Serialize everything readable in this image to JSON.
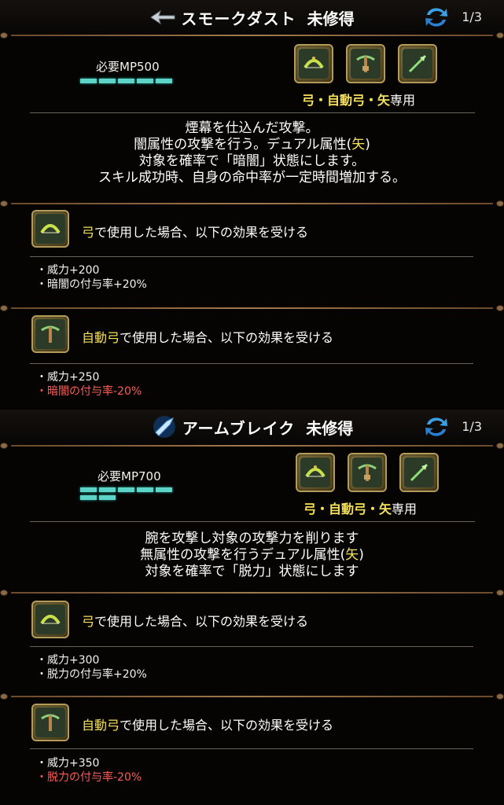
{
  "skills": [
    {
      "name": "スモークダスト",
      "status": "未修得",
      "page": "1/3",
      "mp": "必要MP500",
      "mp_bars": 5,
      "weapons": [
        "bow",
        "crossbow",
        "arrow"
      ],
      "weapon_caption": {
        "hl": "弓・自動弓・矢",
        "plain": "専用"
      },
      "description": [
        [
          {
            "t": "煙幕を仕込んだ攻撃。"
          }
        ],
        [
          {
            "t": "闇属性の攻撃を行う。デュアル属性("
          },
          {
            "t": "矢",
            "hl": true
          },
          {
            "t": ")"
          }
        ],
        [
          {
            "t": "対象を確率で「暗闇」状態にします。"
          }
        ],
        [
          {
            "t": "スキル成功時、自身の命中率が一定時間増加する。"
          }
        ]
      ],
      "effects": [
        {
          "weapon": "bow",
          "head_hl": "弓",
          "head": "で使用した場合、以下の効果を受ける",
          "lines": [
            {
              "t": "・威力+200",
              "neg": false
            },
            {
              "t": "・暗闇の付与率+20%",
              "neg": false
            }
          ]
        },
        {
          "weapon": "crossbow",
          "head_hl": "自動弓",
          "head": "で使用した場合、以下の効果を受ける",
          "lines": [
            {
              "t": "・威力+250",
              "neg": false
            },
            {
              "t": "・暗闇の付与率-20%",
              "neg": true
            }
          ]
        }
      ]
    },
    {
      "name": "アームブレイク",
      "status": "未修得",
      "page": "1/3",
      "mp": "必要MP700",
      "mp_bars": 7,
      "weapons": [
        "bow",
        "crossbow",
        "arrow"
      ],
      "weapon_caption": {
        "hl": "弓・自動弓・矢",
        "plain": "専用"
      },
      "description": [
        [
          {
            "t": "腕を攻撃し対象の攻撃力を削ります"
          }
        ],
        [
          {
            "t": "無属性の攻撃を行うデュアル属性("
          },
          {
            "t": "矢",
            "hl": true
          },
          {
            "t": ")"
          }
        ],
        [
          {
            "t": "対象を確率で「脱力」状態にします"
          }
        ]
      ],
      "effects": [
        {
          "weapon": "bow",
          "head_hl": "弓",
          "head": "で使用した場合、以下の効果を受ける",
          "lines": [
            {
              "t": "・威力+300",
              "neg": false
            },
            {
              "t": "・脱力の付与率+20%",
              "neg": false
            }
          ]
        },
        {
          "weapon": "crossbow",
          "head_hl": "自動弓",
          "head": "で使用した場合、以下の効果を受ける",
          "lines": [
            {
              "t": "・威力+350",
              "neg": false
            },
            {
              "t": "・脱力の付与率-20%",
              "neg": true
            }
          ]
        }
      ]
    }
  ],
  "colors": {
    "highlight": "#f5e15a",
    "negative": "#ff5a55",
    "mp_bar": "#5ed3c7",
    "background": "#050403"
  }
}
